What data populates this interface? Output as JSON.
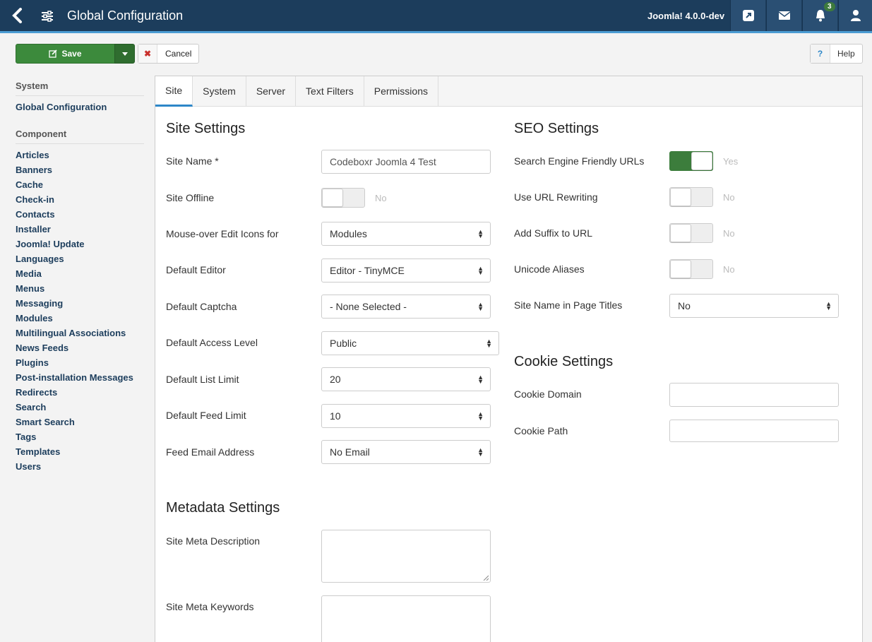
{
  "header": {
    "title": "Global Configuration",
    "version": "Joomla! 4.0.0-dev",
    "notification_count": "3",
    "icons": [
      "back-icon",
      "config-icon",
      "external-link-icon",
      "envelope-icon",
      "bell-icon",
      "user-icon"
    ]
  },
  "toolbar": {
    "save_label": "Save",
    "cancel_label": "Cancel",
    "help_label": "Help",
    "help_q": "?"
  },
  "sidebar": {
    "system_heading": "System",
    "system_items": [
      "Global Configuration"
    ],
    "component_heading": "Component",
    "component_items": [
      "Articles",
      "Banners",
      "Cache",
      "Check-in",
      "Contacts",
      "Installer",
      "Joomla! Update",
      "Languages",
      "Media",
      "Menus",
      "Messaging",
      "Modules",
      "Multilingual Associations",
      "News Feeds",
      "Plugins",
      "Post-installation Messages",
      "Redirects",
      "Search",
      "Smart Search",
      "Tags",
      "Templates",
      "Users"
    ]
  },
  "tabs": [
    "Site",
    "System",
    "Server",
    "Text Filters",
    "Permissions"
  ],
  "site": {
    "title": "Site Settings",
    "site_name_label": "Site Name *",
    "site_name_value": "Codeboxr Joomla 4 Test",
    "offline_label": "Site Offline",
    "offline_value": "No",
    "mouseover_label": "Mouse-over Edit Icons for",
    "mouseover_value": "Modules",
    "editor_label": "Default Editor",
    "editor_value": "Editor - TinyMCE",
    "captcha_label": "Default Captcha",
    "captcha_value": "- None Selected -",
    "access_label": "Default Access Level",
    "access_value": "Public",
    "list_limit_label": "Default List Limit",
    "list_limit_value": "20",
    "feed_limit_label": "Default Feed Limit",
    "feed_limit_value": "10",
    "feed_email_label": "Feed Email Address",
    "feed_email_value": "No Email"
  },
  "metadata": {
    "title": "Metadata Settings",
    "description_label": "Site Meta Description",
    "keywords_label": "Site Meta Keywords"
  },
  "seo": {
    "title": "SEO Settings",
    "sef_label": "Search Engine Friendly URLs",
    "sef_value": "Yes",
    "rewrite_label": "Use URL Rewriting",
    "rewrite_value": "No",
    "suffix_label": "Add Suffix to URL",
    "suffix_value": "No",
    "unicode_label": "Unicode Aliases",
    "unicode_value": "No",
    "sitename_titles_label": "Site Name in Page Titles",
    "sitename_titles_value": "No"
  },
  "cookie": {
    "title": "Cookie Settings",
    "domain_label": "Cookie Domain",
    "path_label": "Cookie Path"
  }
}
